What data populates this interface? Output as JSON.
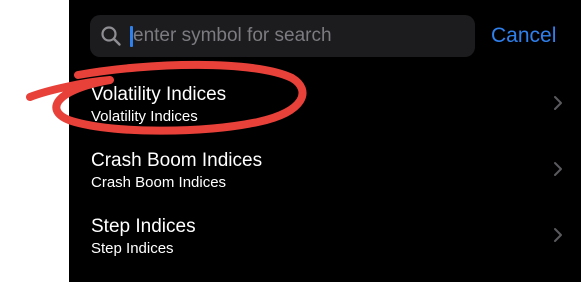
{
  "search": {
    "placeholder": "enter symbol for search",
    "icon": "search-icon",
    "cancel_label": "Cancel",
    "accent_color": "#2f80ed"
  },
  "list": {
    "items": [
      {
        "title": "Volatility Indices",
        "subtitle": "Volatility Indices",
        "icon": "chevron-right-icon"
      },
      {
        "title": "Crash Boom Indices",
        "subtitle": "Crash Boom Indices",
        "icon": "chevron-right-icon"
      },
      {
        "title": "Step Indices",
        "subtitle": "Step Indices",
        "icon": "chevron-right-icon"
      }
    ]
  },
  "annotation": {
    "color": "#e8413a",
    "shape": "hand-drawn-ellipse"
  }
}
